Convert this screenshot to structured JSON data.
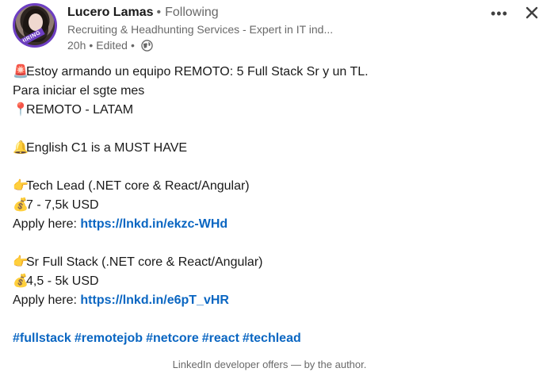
{
  "author": {
    "name": "Lucero Lamas",
    "separator": "•",
    "follow_status": "Following",
    "headline": "Recruiting & Headhunting Services - Expert in IT ind...",
    "time": "20h",
    "edited": "Edited",
    "badge": "#HIRING"
  },
  "icons": {
    "more": "more-icon",
    "close": "close-icon",
    "visibility": "globe-icon"
  },
  "post": {
    "line1_emoji": "🚨",
    "line1_text": "Estoy armando un equipo REMOTO: 5 Full Stack Sr y un TL.",
    "line2_text": "Para iniciar el sgte mes",
    "line3_emoji": "📍",
    "line3_text": "REMOTO - LATAM",
    "line4_emoji": "🔔",
    "line4_text": "English C1 is a MUST HAVE",
    "role1": {
      "emoji": "👉",
      "title": "Tech Lead (.NET core & React/Angular)",
      "money_emoji": "💰",
      "salary": "7 - 7,5k USD",
      "apply_label": "Apply here: ",
      "link": "https://lnkd.in/ekzc-WHd"
    },
    "role2": {
      "emoji": "👉",
      "title": "Sr Full Stack (.NET core & React/Angular)",
      "money_emoji": "💰",
      "salary": "4,5 - 5k USD",
      "apply_label": "Apply here: ",
      "link": "https://lnkd.in/e6pT_vHR"
    },
    "hashtags": [
      "#fullstack",
      "#remotejob",
      "#netcore",
      "#react",
      "#techlead"
    ]
  },
  "footer": {
    "text": "LinkedIn developer offers — by the author."
  }
}
